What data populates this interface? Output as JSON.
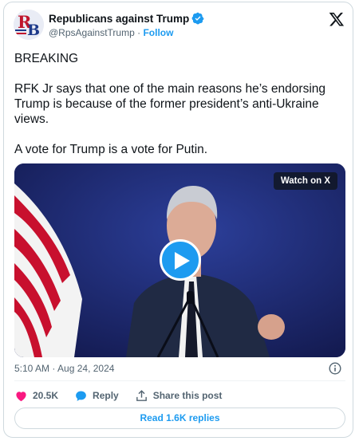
{
  "author": {
    "display_name": "Republicans against Trump",
    "handle": "@RpsAgainstTrump",
    "separator": "·",
    "follow_label": "Follow",
    "avatar_icon": "rb-logo",
    "verified_icon": "verified-badge-icon"
  },
  "tweet": {
    "paragraphs": [
      "BREAKING",
      "RFK Jr says that one of the main reasons he’s endorsing Trump is because of the former president’s anti-Ukraine views.",
      "A vote for Trump is a vote for Putin."
    ]
  },
  "media": {
    "badge_label": "Watch on X",
    "play_icon": "play-icon"
  },
  "meta": {
    "time": "5:10 AM",
    "separator": "·",
    "date": "Aug 24, 2024",
    "info_icon": "info-icon"
  },
  "actions": {
    "like_count": "20.5K",
    "reply_label": "Reply",
    "share_label": "Share this post"
  },
  "replies_button": "Read 1.6K replies",
  "colors": {
    "accent": "#1d9bf0",
    "like": "#f91880",
    "text": "#0f1419",
    "muted": "#536471",
    "border": "#cfd9de",
    "video_bg": "#1b2566"
  }
}
